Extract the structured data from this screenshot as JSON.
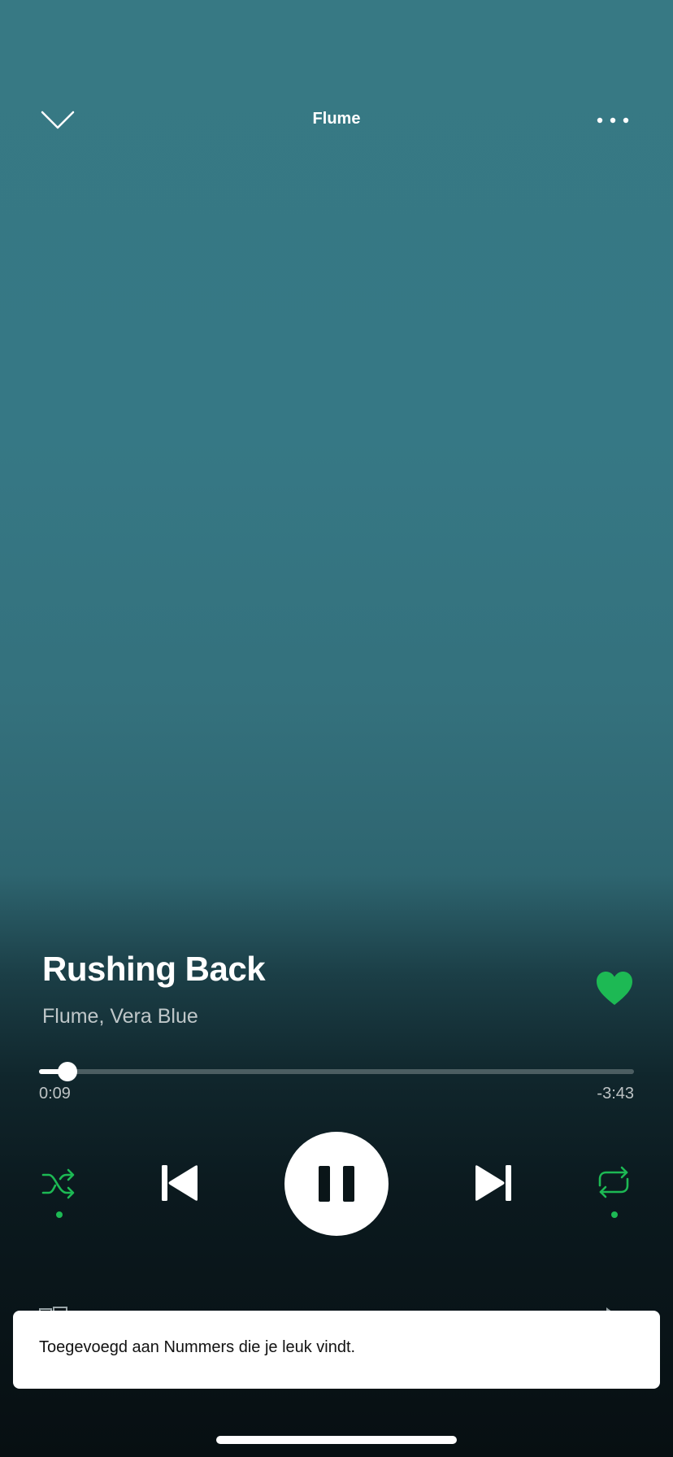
{
  "header": {
    "title": "Flume",
    "collapse_icon": "chevron-down-icon",
    "more_icon": "more-horizontal-icon"
  },
  "track": {
    "title": "Rushing Back",
    "artist": "Flume, Vera Blue",
    "liked": true,
    "like_icon": "heart-filled-icon"
  },
  "progress": {
    "elapsed": "0:09",
    "remaining": "-3:43",
    "fraction": 0.048
  },
  "controls": {
    "shuffle_icon": "shuffle-icon",
    "shuffle_active": true,
    "previous_icon": "skip-previous-icon",
    "play_pause_icon": "pause-icon",
    "next_icon": "skip-next-icon",
    "repeat_icon": "repeat-icon",
    "repeat_active": true
  },
  "toast": {
    "message": "Toegevoegd aan Nummers die je leuk vindt."
  },
  "colors": {
    "accent": "#1db954",
    "background_top": "#377984",
    "background_bottom": "#070f12",
    "toast_background": "#ffffff"
  }
}
